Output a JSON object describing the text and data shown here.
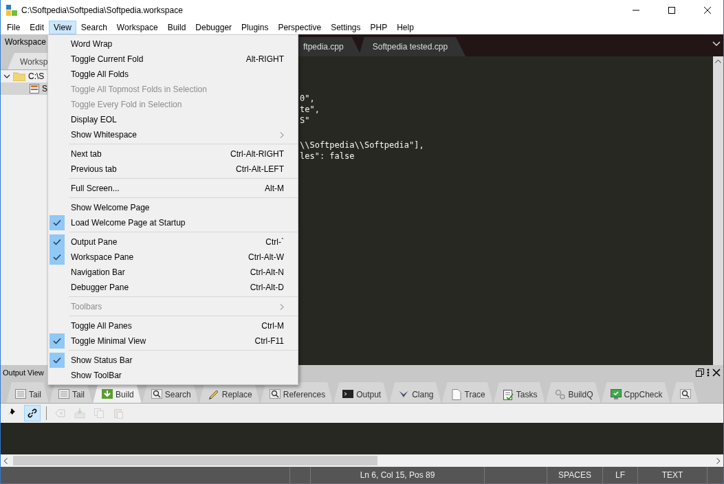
{
  "window": {
    "title": "C:\\Softpedia\\Softpedia\\Softpedia.workspace"
  },
  "menubar": [
    {
      "label": "File",
      "selected": false
    },
    {
      "label": "Edit",
      "selected": false
    },
    {
      "label": "View",
      "selected": true
    },
    {
      "label": "Search",
      "selected": false
    },
    {
      "label": "Workspace",
      "selected": false
    },
    {
      "label": "Build",
      "selected": false
    },
    {
      "label": "Debugger",
      "selected": false
    },
    {
      "label": "Plugins",
      "selected": false
    },
    {
      "label": "Perspective",
      "selected": false
    },
    {
      "label": "Settings",
      "selected": false
    },
    {
      "label": "PHP",
      "selected": false
    },
    {
      "label": "Help",
      "selected": false
    }
  ],
  "workspace_pane": {
    "title": "Workspace",
    "tab": "Worksp",
    "tree": [
      {
        "label": "C:\\S",
        "expanded": true,
        "selected": false,
        "children": [
          {
            "label": "S",
            "selected": true
          }
        ]
      }
    ]
  },
  "editor": {
    "tabs": [
      {
        "label": "ftpedia.cpp",
        "selected": false
      },
      {
        "label": "Softpedia tested.cpp",
        "selected": false
      }
    ],
    "lines": [
      {
        "text": "0\",",
        "gap_before": false
      },
      {
        "text": "te\",",
        "gap_before": false
      },
      {
        "text": "S\"",
        "gap_before": false
      },
      {
        "text": "\\\\Softpedia\\\\Softpedia\"],",
        "gap_before": true
      },
      {
        "text": "les\": false",
        "gap_before": false
      }
    ]
  },
  "view_menu": [
    {
      "kind": "item",
      "label": "Word Wrap",
      "checked": false,
      "disabled": false
    },
    {
      "kind": "item",
      "label": "Toggle Current Fold",
      "shortcut": "Alt-RIGHT",
      "checked": false,
      "disabled": false
    },
    {
      "kind": "item",
      "label": "Toggle All Folds",
      "checked": false,
      "disabled": false
    },
    {
      "kind": "item",
      "label": "Toggle All Topmost Folds in Selection",
      "checked": false,
      "disabled": true
    },
    {
      "kind": "item",
      "label": "Toggle Every Fold in Selection",
      "checked": false,
      "disabled": true
    },
    {
      "kind": "item",
      "label": "Display EOL",
      "checked": false,
      "disabled": false
    },
    {
      "kind": "item",
      "label": "Show Whitespace",
      "checked": false,
      "disabled": false,
      "submenu": true
    },
    {
      "kind": "separator"
    },
    {
      "kind": "item",
      "label": "Next tab",
      "shortcut": "Ctrl-Alt-RIGHT",
      "checked": false,
      "disabled": false
    },
    {
      "kind": "item",
      "label": "Previous tab",
      "shortcut": "Ctrl-Alt-LEFT",
      "checked": false,
      "disabled": false
    },
    {
      "kind": "separator"
    },
    {
      "kind": "item",
      "label": "Full Screen...",
      "shortcut": "Alt-M",
      "checked": false,
      "disabled": false
    },
    {
      "kind": "separator"
    },
    {
      "kind": "item",
      "label": "Show Welcome Page",
      "checked": false,
      "disabled": false
    },
    {
      "kind": "item",
      "label": "Load Welcome Page at Startup",
      "checked": true,
      "disabled": false
    },
    {
      "kind": "separator"
    },
    {
      "kind": "item",
      "label": "Output Pane",
      "shortcut": "Ctrl-`",
      "checked": true,
      "disabled": false
    },
    {
      "kind": "item",
      "label": "Workspace Pane",
      "shortcut": "Ctrl-Alt-W",
      "checked": true,
      "disabled": false
    },
    {
      "kind": "item",
      "label": "Navigation Bar",
      "shortcut": "Ctrl-Alt-N",
      "checked": false,
      "disabled": false
    },
    {
      "kind": "item",
      "label": "Debugger Pane",
      "shortcut": "Ctrl-Alt-D",
      "checked": false,
      "disabled": false
    },
    {
      "kind": "separator"
    },
    {
      "kind": "item",
      "label": "Toolbars",
      "checked": false,
      "disabled": true,
      "submenu": true
    },
    {
      "kind": "separator"
    },
    {
      "kind": "item",
      "label": "Toggle All Panes",
      "shortcut": "Ctrl-M",
      "checked": false,
      "disabled": false
    },
    {
      "kind": "item",
      "label": "Toggle Minimal View",
      "shortcut": "Ctrl-F11",
      "checked": true,
      "disabled": false
    },
    {
      "kind": "separator"
    },
    {
      "kind": "item",
      "label": "Show Status Bar",
      "checked": true,
      "disabled": false
    },
    {
      "kind": "item",
      "label": "Show ToolBar",
      "checked": false,
      "disabled": false
    }
  ],
  "output_pane": {
    "title": "Output View",
    "tabs": [
      {
        "label": "Tail",
        "kind": "lines",
        "selected": false
      },
      {
        "label": "Tail",
        "kind": "lines",
        "selected": false
      },
      {
        "label": "Build",
        "kind": "download",
        "selected": true
      },
      {
        "label": "Search",
        "kind": "magnifier",
        "selected": false
      },
      {
        "label": "Replace",
        "kind": "pencil",
        "selected": false
      },
      {
        "label": "References",
        "kind": "magnifier",
        "selected": false
      },
      {
        "label": "Output",
        "kind": "terminal",
        "selected": false
      },
      {
        "label": "Clang",
        "kind": "wing",
        "selected": false
      },
      {
        "label": "Trace",
        "kind": "page",
        "selected": false
      },
      {
        "label": "Tasks",
        "kind": "clipboard",
        "selected": false
      },
      {
        "label": "BuildQ",
        "kind": "gears",
        "selected": false
      },
      {
        "label": "CppCheck",
        "kind": "monitor",
        "selected": false
      },
      {
        "kind": "magnifier",
        "selected": false
      }
    ],
    "toolbar": [
      {
        "kind": "pin",
        "active": false,
        "disabled": false
      },
      {
        "kind": "link",
        "active": true,
        "disabled": false
      },
      {
        "kind": "separator"
      },
      {
        "kind": "clear",
        "active": false,
        "disabled": true
      },
      {
        "kind": "save",
        "active": false,
        "disabled": true
      },
      {
        "kind": "copy",
        "active": false,
        "disabled": true
      },
      {
        "kind": "paste",
        "active": false,
        "disabled": true
      }
    ]
  },
  "status_bar": {
    "position": "Ln 6, Col 15, Pos 89",
    "indent": "SPACES",
    "eol": "LF",
    "mode": "TEXT"
  }
}
